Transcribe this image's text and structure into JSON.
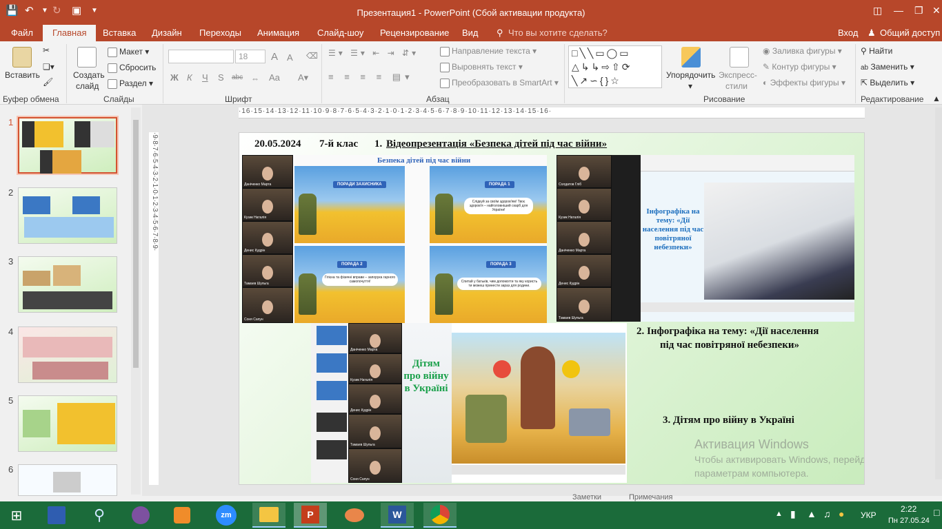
{
  "window": {
    "title": "Презентация1 - PowerPoint (Сбой активации продукта)"
  },
  "tabs": [
    "Файл",
    "Главная",
    "Вставка",
    "Дизайн",
    "Переходы",
    "Анимация",
    "Слайд-шоу",
    "Рецензирование",
    "Вид"
  ],
  "tell_me": "Что вы хотите сделать?",
  "sign_in": "Вход",
  "share": "Общий доступ",
  "ribbon": {
    "clipboard": {
      "paste": "Вставить",
      "label": "Буфер обмена"
    },
    "slides": {
      "new_slide_line1": "Создать",
      "new_slide_line2": "слайд",
      "layout": "Макет",
      "reset": "Сбросить",
      "section": "Раздел",
      "label": "Слайды"
    },
    "font": {
      "size": "18",
      "label": "Шрифт",
      "bold": "Ж",
      "italic": "К",
      "underline": "Ч",
      "shadow": "S",
      "strike": "abc",
      "case": "Aa",
      "grow": "A",
      "shrink": "A"
    },
    "paragraph": {
      "text_direction": "Направление текста",
      "align_text": "Выровнять текст",
      "smartart": "Преобразовать в SmartArt",
      "label": "Абзац"
    },
    "drawing": {
      "arrange": "Упорядочить",
      "quick_styles_1": "Экспресс-",
      "quick_styles_2": "стили",
      "fill": "Заливка фигуры",
      "outline": "Контур фигуры",
      "effects": "Эффекты фигуры",
      "label": "Рисование"
    },
    "editing": {
      "find": "Найти",
      "replace": "Заменить",
      "select": "Выделить",
      "label": "Редактирование"
    }
  },
  "ruler_h": "·16·15·14·13·12·11·10·9·8·7·6·5·4·3·2·1·0·1·2·3·4·5·6·7·8·9·10·11·12·13·14·15·16·",
  "ruler_v": "·9·8·7·6·5·4·3·2·1·0·1·2·3·4·5·6·7·8·9·",
  "slide_numbers": [
    "1",
    "2",
    "3",
    "4",
    "5",
    "6"
  ],
  "slide": {
    "date": "20.05.2024",
    "grade": "7-й клас",
    "item1_num": "1.",
    "item1_text": "Відеопрезентація «Безпека дітей під час війни»",
    "item2": "2. Інфографіка на тему: «Дії населення",
    "item2b": "під час повітряної небезпеки»",
    "item3": "3.  Дітям про війну в Україні",
    "poster_header": "Безпека дітей під час війни",
    "poster_tips": [
      "ПОРАДИ ЗАХИСНИКА",
      "ПОРАДА 1",
      "ПОРАДА 2",
      "ПОРАДА 3"
    ],
    "poster_bubbles": [
      "Слідкуй за своїм здоров'ям! Твоє здоров'я – найголовніший скарб для України!",
      "Гігієна та фізичні вправи – запорука гарного самопочуття!",
      "Спитай у батьків, чим допомогти та яку користь ти можеш принести зараз для родини."
    ],
    "infographic_text": "Інфографіка на тему: «Дії населення під час повітряної небезпеки»",
    "kids_text": "Дітям про війну в Україні",
    "cam_names_a": [
      "Даніченко Марта",
      "Кузик Наталія",
      "Денис Кудрін",
      "Тамаев Шульга",
      "Соня Сапун"
    ],
    "cam_names_b": [
      "Солдатов Гліб",
      "Кузик Наталія",
      "Даніченко Марта",
      "Денис Кудрін",
      "Тамаев Шульга"
    ]
  },
  "watermark": {
    "title": "Активация Windows",
    "line1": "Чтобы активировать Windows, перейдите к",
    "line2": "параметрам компьютера."
  },
  "status": {
    "notes": "Заметки",
    "comments": "Примечания"
  },
  "taskbar": {
    "lang": "УКР",
    "time": "2:22",
    "date": "Пн 27.05.24"
  },
  "colors": {
    "accent": "#b7472a",
    "taskbar": "#1b6b3a"
  }
}
